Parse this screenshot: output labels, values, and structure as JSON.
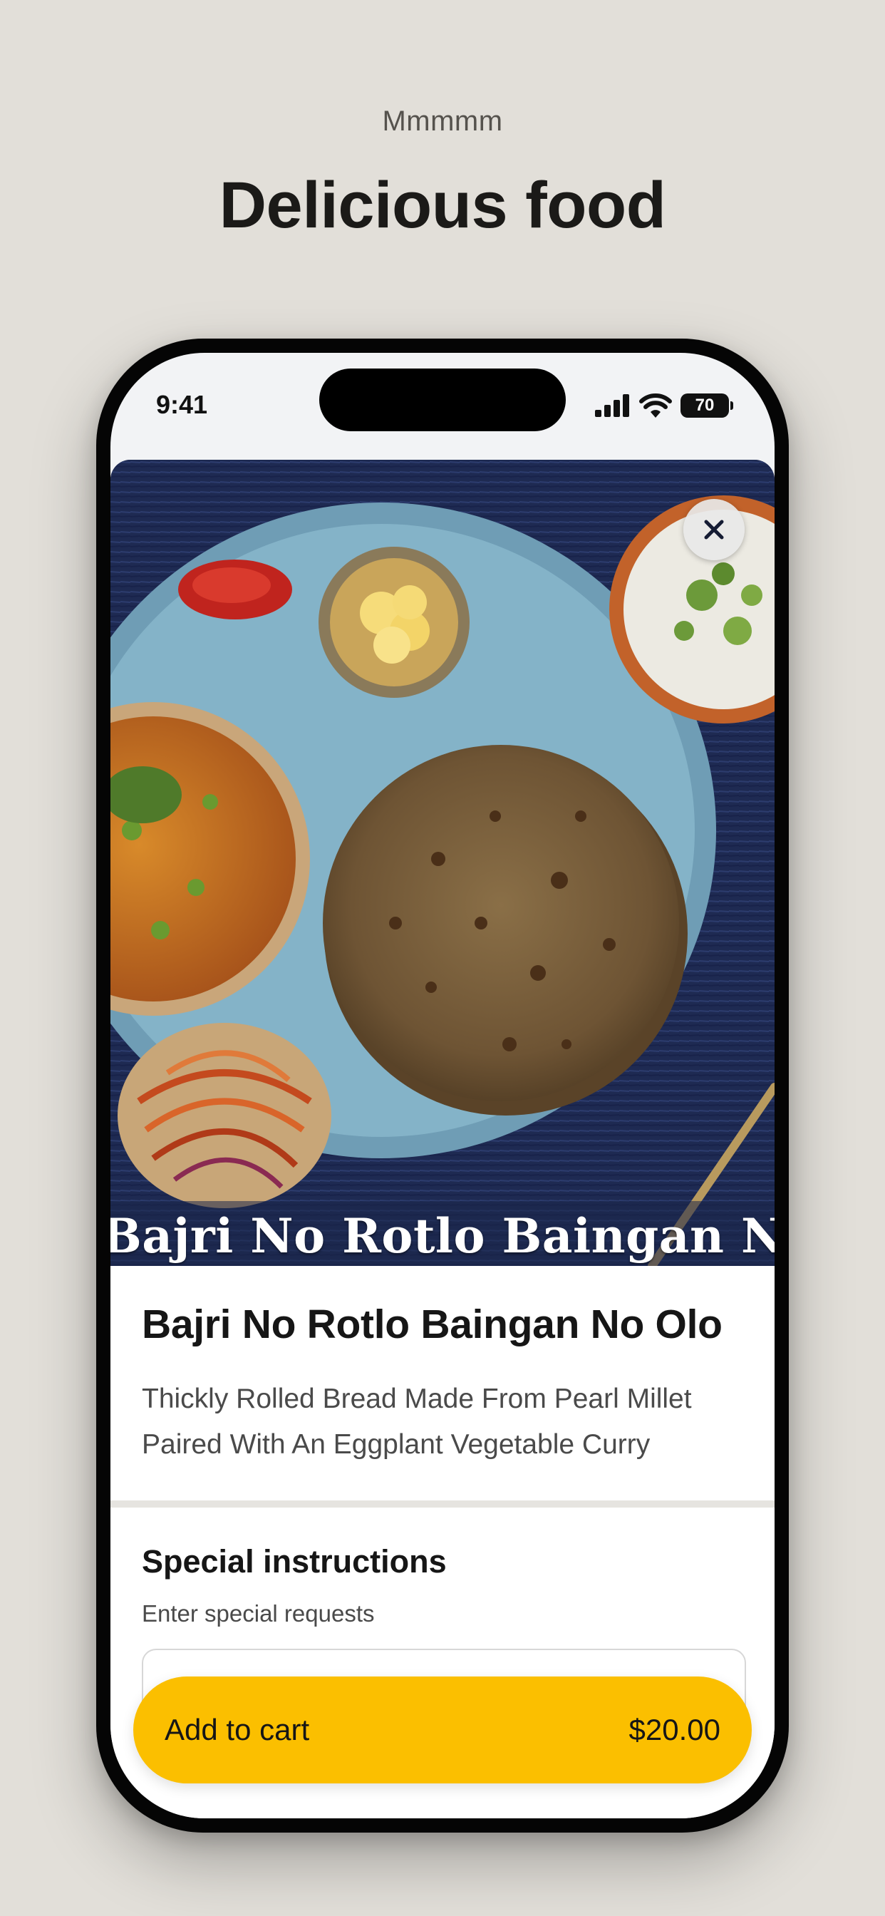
{
  "promo": {
    "kicker": "Mmmmm",
    "headline": "Delicious food"
  },
  "status_bar": {
    "time": "9:41",
    "battery": "70",
    "icons": [
      "cellular-signal-icon",
      "wifi-icon",
      "battery-icon"
    ]
  },
  "item": {
    "image_caption": "Bajri No Rotlo Baingan No Olo",
    "title": "Bajri No Rotlo Baingan No Olo",
    "description": "Thickly Rolled Bread Made From Pearl Millet Paired With An Eggplant Vegetable Curry"
  },
  "special_instructions": {
    "title": "Special instructions",
    "subtitle": "Enter special requests",
    "value": ""
  },
  "cart_button": {
    "label": "Add to cart",
    "price": "$20.00"
  },
  "colors": {
    "background": "#e2dfd9",
    "accent": "#fbbf00",
    "text": "#161616"
  }
}
